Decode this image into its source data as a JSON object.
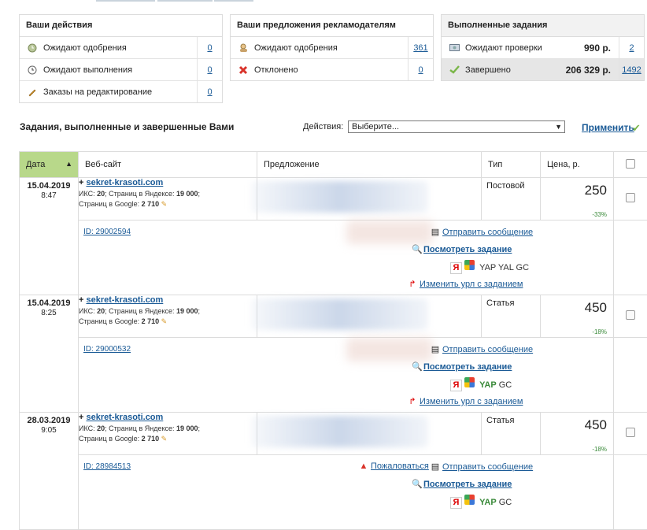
{
  "my_actions": {
    "title": "Ваши действия",
    "rows": [
      {
        "icon": "clock-pending-icon",
        "label": "Ожидают одобрения",
        "count": "0"
      },
      {
        "icon": "clock-icon",
        "label": "Ожидают выполнения",
        "count": "0"
      },
      {
        "icon": "pencil-icon",
        "label": "Заказы на редактирование",
        "count": "0"
      }
    ]
  },
  "offers": {
    "title": "Ваши предложения рекламодателям",
    "rows": [
      {
        "icon": "user-pending-icon",
        "label": "Ожидают одобрения",
        "count": "361"
      },
      {
        "icon": "cross-icon",
        "label": "Отклонено",
        "count": "0"
      }
    ]
  },
  "completed": {
    "title": "Выполненные задания",
    "rows": [
      {
        "icon": "money-icon",
        "label": "Ожидают проверки",
        "sum": "990 р.",
        "count": "2"
      },
      {
        "icon": "checkmark-icon",
        "label": "Завершено",
        "sum": "206 329 р.",
        "count": "1492"
      }
    ]
  },
  "section_title": "Задания, выполненные и завершенные Вами",
  "actions": {
    "label": "Действия:",
    "selected": "Выберите...",
    "apply": "Применить"
  },
  "table": {
    "headers": [
      "Дата",
      "Веб-сайт",
      "Предложение",
      "Тип",
      "Цена, р."
    ],
    "rows": [
      {
        "date": "15.04.2019",
        "time": "8:47",
        "site": "sekret-krasoti.com",
        "iks_label": "ИКС:",
        "iks": "20",
        "yandex_label": "; Страниц в Яндексе:",
        "yandex": "19 000",
        "google_label": "Страниц в Google:",
        "google": "2 710",
        "type": "Постовой",
        "price": "250",
        "delta": "-33%",
        "id": "ID: 29002594",
        "send": "Отправить сообщение",
        "view": "Посмотреть задание",
        "engines": "YAP YAL GC",
        "change": "Изменить урл с заданием"
      },
      {
        "date": "15.04.2019",
        "time": "8:25",
        "site": "sekret-krasoti.com",
        "iks_label": "ИКС:",
        "iks": "20",
        "yandex_label": "; Страниц в Яндексе:",
        "yandex": "19 000",
        "google_label": "Страниц в Google:",
        "google": "2 710",
        "type": "Статья",
        "price": "450",
        "delta": "-18%",
        "id": "ID: 29000532",
        "send": "Отправить сообщение",
        "view": "Посмотреть задание",
        "engines_green": "YAP",
        "engines_rest": "GC",
        "change": "Изменить урл с заданием"
      },
      {
        "date": "28.03.2019",
        "time": "9:05",
        "site": "sekret-krasoti.com",
        "iks_label": "ИКС:",
        "iks": "20",
        "yandex_label": "; Страниц в Яндексе:",
        "yandex": "19 000",
        "google_label": "Страниц в Google:",
        "google": "2 710",
        "type": "Статья",
        "price": "450",
        "delta": "-18%",
        "id": "ID: 28984513",
        "complain": "Пожаловаться",
        "send": "Отправить сообщение",
        "view": "Посмотреть задание",
        "engines_green": "YAP",
        "engines_rest": "GC"
      }
    ]
  }
}
